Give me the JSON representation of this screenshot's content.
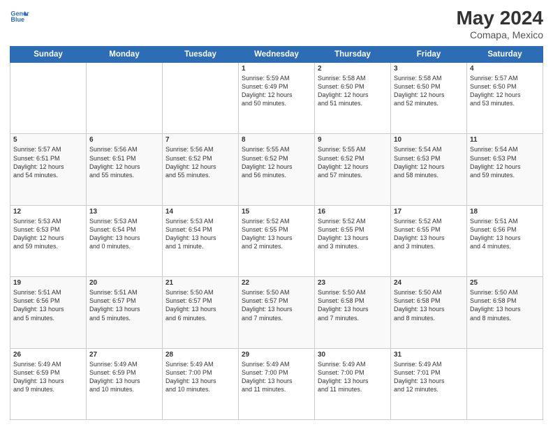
{
  "header": {
    "logo_line1": "General",
    "logo_line2": "Blue",
    "month_year": "May 2024",
    "location": "Comapa, Mexico"
  },
  "weekdays": [
    "Sunday",
    "Monday",
    "Tuesday",
    "Wednesday",
    "Thursday",
    "Friday",
    "Saturday"
  ],
  "weeks": [
    [
      {
        "day": "",
        "info": ""
      },
      {
        "day": "",
        "info": ""
      },
      {
        "day": "",
        "info": ""
      },
      {
        "day": "1",
        "info": "Sunrise: 5:59 AM\nSunset: 6:49 PM\nDaylight: 12 hours\nand 50 minutes."
      },
      {
        "day": "2",
        "info": "Sunrise: 5:58 AM\nSunset: 6:50 PM\nDaylight: 12 hours\nand 51 minutes."
      },
      {
        "day": "3",
        "info": "Sunrise: 5:58 AM\nSunset: 6:50 PM\nDaylight: 12 hours\nand 52 minutes."
      },
      {
        "day": "4",
        "info": "Sunrise: 5:57 AM\nSunset: 6:50 PM\nDaylight: 12 hours\nand 53 minutes."
      }
    ],
    [
      {
        "day": "5",
        "info": "Sunrise: 5:57 AM\nSunset: 6:51 PM\nDaylight: 12 hours\nand 54 minutes."
      },
      {
        "day": "6",
        "info": "Sunrise: 5:56 AM\nSunset: 6:51 PM\nDaylight: 12 hours\nand 55 minutes."
      },
      {
        "day": "7",
        "info": "Sunrise: 5:56 AM\nSunset: 6:52 PM\nDaylight: 12 hours\nand 55 minutes."
      },
      {
        "day": "8",
        "info": "Sunrise: 5:55 AM\nSunset: 6:52 PM\nDaylight: 12 hours\nand 56 minutes."
      },
      {
        "day": "9",
        "info": "Sunrise: 5:55 AM\nSunset: 6:52 PM\nDaylight: 12 hours\nand 57 minutes."
      },
      {
        "day": "10",
        "info": "Sunrise: 5:54 AM\nSunset: 6:53 PM\nDaylight: 12 hours\nand 58 minutes."
      },
      {
        "day": "11",
        "info": "Sunrise: 5:54 AM\nSunset: 6:53 PM\nDaylight: 12 hours\nand 59 minutes."
      }
    ],
    [
      {
        "day": "12",
        "info": "Sunrise: 5:53 AM\nSunset: 6:53 PM\nDaylight: 12 hours\nand 59 minutes."
      },
      {
        "day": "13",
        "info": "Sunrise: 5:53 AM\nSunset: 6:54 PM\nDaylight: 13 hours\nand 0 minutes."
      },
      {
        "day": "14",
        "info": "Sunrise: 5:53 AM\nSunset: 6:54 PM\nDaylight: 13 hours\nand 1 minute."
      },
      {
        "day": "15",
        "info": "Sunrise: 5:52 AM\nSunset: 6:55 PM\nDaylight: 13 hours\nand 2 minutes."
      },
      {
        "day": "16",
        "info": "Sunrise: 5:52 AM\nSunset: 6:55 PM\nDaylight: 13 hours\nand 3 minutes."
      },
      {
        "day": "17",
        "info": "Sunrise: 5:52 AM\nSunset: 6:55 PM\nDaylight: 13 hours\nand 3 minutes."
      },
      {
        "day": "18",
        "info": "Sunrise: 5:51 AM\nSunset: 6:56 PM\nDaylight: 13 hours\nand 4 minutes."
      }
    ],
    [
      {
        "day": "19",
        "info": "Sunrise: 5:51 AM\nSunset: 6:56 PM\nDaylight: 13 hours\nand 5 minutes."
      },
      {
        "day": "20",
        "info": "Sunrise: 5:51 AM\nSunset: 6:57 PM\nDaylight: 13 hours\nand 5 minutes."
      },
      {
        "day": "21",
        "info": "Sunrise: 5:50 AM\nSunset: 6:57 PM\nDaylight: 13 hours\nand 6 minutes."
      },
      {
        "day": "22",
        "info": "Sunrise: 5:50 AM\nSunset: 6:57 PM\nDaylight: 13 hours\nand 7 minutes."
      },
      {
        "day": "23",
        "info": "Sunrise: 5:50 AM\nSunset: 6:58 PM\nDaylight: 13 hours\nand 7 minutes."
      },
      {
        "day": "24",
        "info": "Sunrise: 5:50 AM\nSunset: 6:58 PM\nDaylight: 13 hours\nand 8 minutes."
      },
      {
        "day": "25",
        "info": "Sunrise: 5:50 AM\nSunset: 6:58 PM\nDaylight: 13 hours\nand 8 minutes."
      }
    ],
    [
      {
        "day": "26",
        "info": "Sunrise: 5:49 AM\nSunset: 6:59 PM\nDaylight: 13 hours\nand 9 minutes."
      },
      {
        "day": "27",
        "info": "Sunrise: 5:49 AM\nSunset: 6:59 PM\nDaylight: 13 hours\nand 10 minutes."
      },
      {
        "day": "28",
        "info": "Sunrise: 5:49 AM\nSunset: 7:00 PM\nDaylight: 13 hours\nand 10 minutes."
      },
      {
        "day": "29",
        "info": "Sunrise: 5:49 AM\nSunset: 7:00 PM\nDaylight: 13 hours\nand 11 minutes."
      },
      {
        "day": "30",
        "info": "Sunrise: 5:49 AM\nSunset: 7:00 PM\nDaylight: 13 hours\nand 11 minutes."
      },
      {
        "day": "31",
        "info": "Sunrise: 5:49 AM\nSunset: 7:01 PM\nDaylight: 13 hours\nand 12 minutes."
      },
      {
        "day": "",
        "info": ""
      }
    ]
  ]
}
